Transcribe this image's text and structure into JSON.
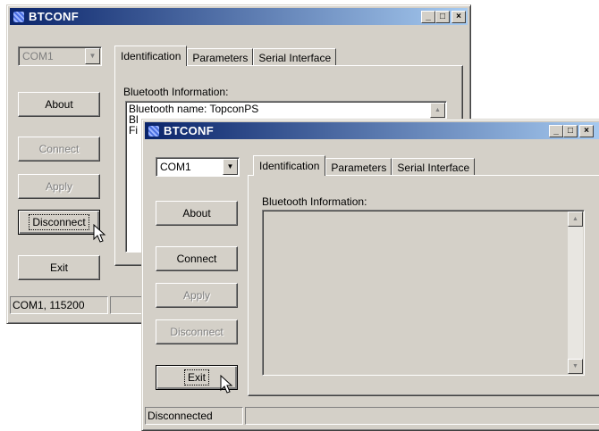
{
  "back_window": {
    "title": "BTCONF",
    "title_buttons": {
      "minimize": "_",
      "maximize": "□",
      "close": "×"
    },
    "port_select": {
      "value": "COM1"
    },
    "tabs": [
      "Identification",
      "Parameters",
      "Serial Interface"
    ],
    "group_label": "Bluetooth Information:",
    "info_lines": [
      "Bluetooth name: TopconPS",
      "Bl",
      "Fi"
    ],
    "buttons": {
      "about": "About",
      "connect": "Connect",
      "apply": "Apply",
      "disconnect": "Disconnect",
      "exit": "Exit"
    },
    "status": "COM1, 115200"
  },
  "front_window": {
    "title": "BTCONF",
    "title_buttons": {
      "minimize": "_",
      "maximize": "□",
      "close": "×"
    },
    "port_select": {
      "value": "COM1"
    },
    "tabs": [
      "Identification",
      "Parameters",
      "Serial Interface"
    ],
    "group_label": "Bluetooth Information:",
    "buttons": {
      "about": "About",
      "connect": "Connect",
      "apply": "Apply",
      "disconnect": "Disconnect",
      "exit": "Exit"
    },
    "status": "Disconnected"
  },
  "icons": {
    "scroll_up": "▲",
    "scroll_down": "▼",
    "dropdown": "▼"
  }
}
